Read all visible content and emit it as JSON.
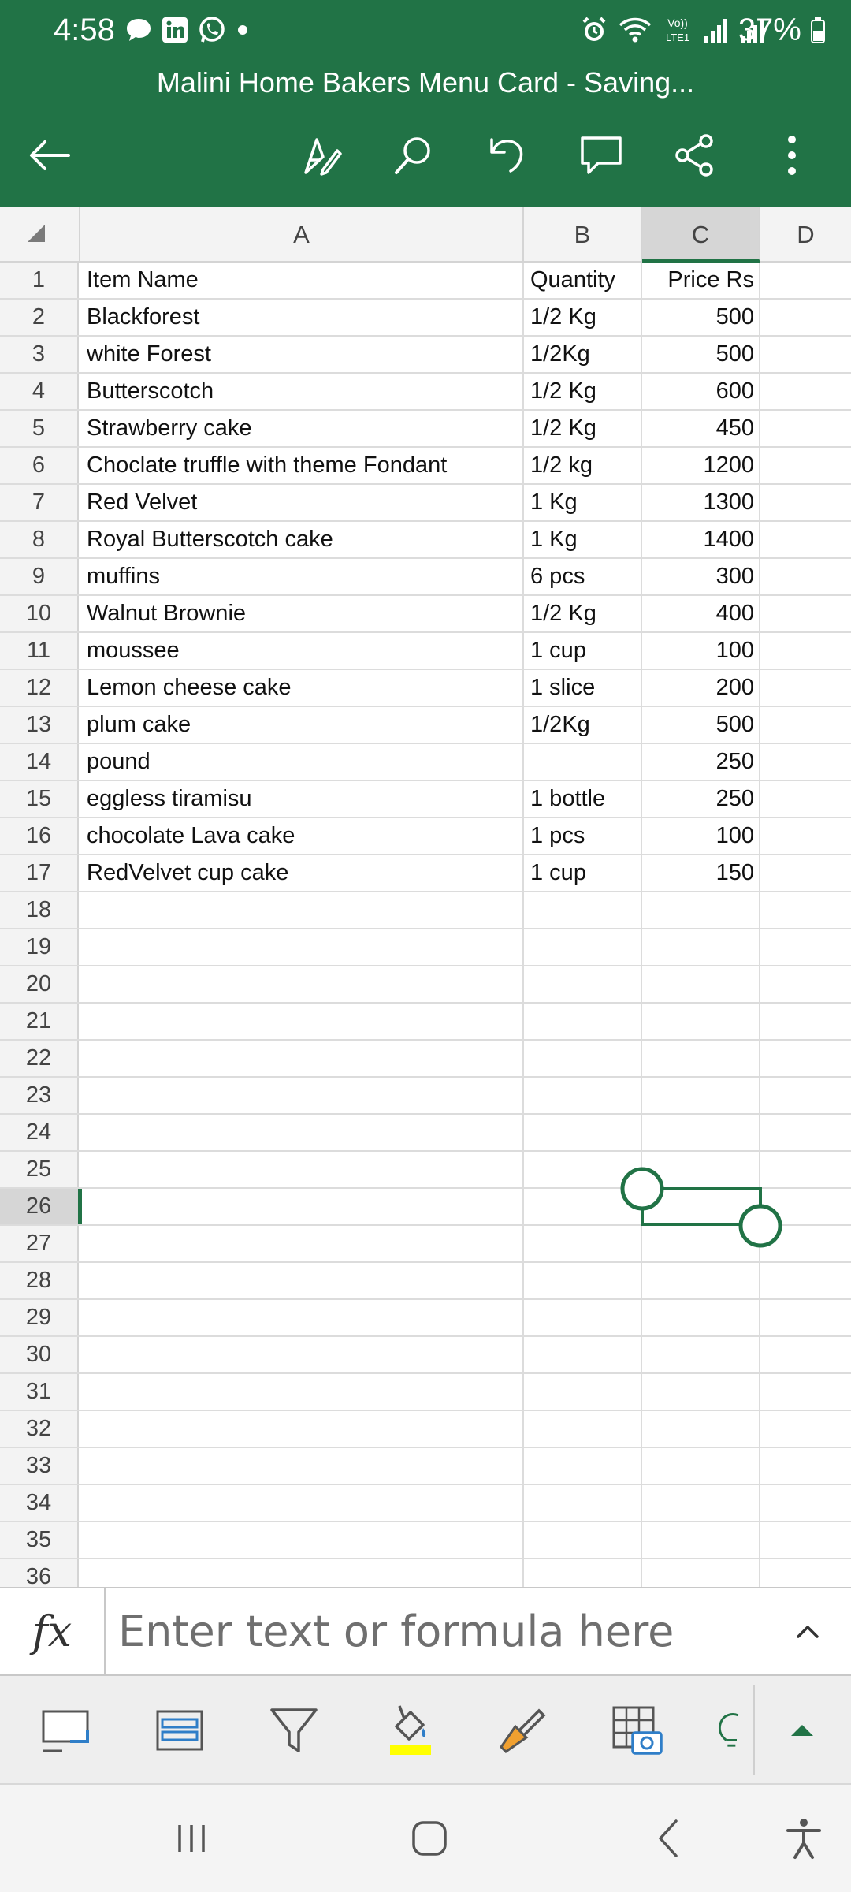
{
  "status_bar": {
    "time": "4:58",
    "battery": "37%",
    "left_icons": [
      "chat-bubble-icon",
      "linkedin-icon",
      "whatsapp-icon",
      "dot-icon"
    ],
    "right_icons": [
      "alarm-icon",
      "wifi-icon",
      "volte-icon",
      "signal-icon",
      "signal-icon",
      "battery-icon"
    ],
    "volte_label": "Vo))\nLTE1"
  },
  "header": {
    "title": "Malini Home Bakers Menu Card - Saving...",
    "toolbar": [
      "back-arrow-icon",
      "draw-pen-icon",
      "search-icon",
      "undo-icon",
      "comment-icon",
      "share-icon",
      "more-vertical-icon"
    ]
  },
  "sheet": {
    "columns": [
      "A",
      "B",
      "C",
      "D"
    ],
    "selected_column": "C",
    "selected_row": 26,
    "rows": [
      {
        "n": "1",
        "a": "Item Name",
        "b": "Quantity",
        "c": "Price Rs"
      },
      {
        "n": "2",
        "a": "Blackforest",
        "b": "1/2 Kg",
        "c": "500"
      },
      {
        "n": "3",
        "a": "white Forest",
        "b": "1/2Kg",
        "c": "500"
      },
      {
        "n": "4",
        "a": "Butterscotch",
        "b": "1/2 Kg",
        "c": "600"
      },
      {
        "n": "5",
        "a": "Strawberry cake",
        "b": "1/2 Kg",
        "c": "450"
      },
      {
        "n": "6",
        "a": "Choclate truffle with theme Fondant",
        "b": "1/2 kg",
        "c": "1200"
      },
      {
        "n": "7",
        "a": "Red Velvet",
        "b": "1 Kg",
        "c": "1300"
      },
      {
        "n": "8",
        "a": "Royal Butterscotch cake",
        "b": "1 Kg",
        "c": "1400"
      },
      {
        "n": "9",
        "a": "muffins",
        "b": "6 pcs",
        "c": "300"
      },
      {
        "n": "10",
        "a": "Walnut Brownie",
        "b": "1/2 Kg",
        "c": "400"
      },
      {
        "n": "11",
        "a": "moussee",
        "b": "1 cup",
        "c": "100"
      },
      {
        "n": "12",
        "a": "Lemon cheese cake",
        "b": "1 slice",
        "c": "200"
      },
      {
        "n": "13",
        "a": "plum cake",
        "b": "1/2Kg",
        "c": "500"
      },
      {
        "n": "14",
        "a": "pound",
        "b": "",
        "c": "250"
      },
      {
        "n": "15",
        "a": "eggless tiramisu",
        "b": "1 bottle",
        "c": "250"
      },
      {
        "n": "16",
        "a": "chocolate Lava cake",
        "b": "1 pcs",
        "c": "100"
      },
      {
        "n": "17",
        "a": "RedVelvet cup cake",
        "b": "1 cup",
        "c": "150"
      },
      {
        "n": "18",
        "a": "",
        "b": "",
        "c": ""
      },
      {
        "n": "19",
        "a": "",
        "b": "",
        "c": ""
      },
      {
        "n": "20",
        "a": "",
        "b": "",
        "c": ""
      },
      {
        "n": "21",
        "a": "",
        "b": "",
        "c": ""
      },
      {
        "n": "22",
        "a": "",
        "b": "",
        "c": ""
      },
      {
        "n": "23",
        "a": "",
        "b": "",
        "c": ""
      },
      {
        "n": "24",
        "a": "",
        "b": "",
        "c": ""
      },
      {
        "n": "25",
        "a": "",
        "b": "",
        "c": ""
      },
      {
        "n": "26",
        "a": "",
        "b": "",
        "c": ""
      },
      {
        "n": "27",
        "a": "",
        "b": "",
        "c": ""
      },
      {
        "n": "28",
        "a": "",
        "b": "",
        "c": ""
      },
      {
        "n": "29",
        "a": "",
        "b": "",
        "c": ""
      },
      {
        "n": "30",
        "a": "",
        "b": "",
        "c": ""
      },
      {
        "n": "31",
        "a": "",
        "b": "",
        "c": ""
      },
      {
        "n": "32",
        "a": "",
        "b": "",
        "c": ""
      },
      {
        "n": "33",
        "a": "",
        "b": "",
        "c": ""
      },
      {
        "n": "34",
        "a": "",
        "b": "",
        "c": ""
      },
      {
        "n": "35",
        "a": "",
        "b": "",
        "c": ""
      },
      {
        "n": "36",
        "a": "",
        "b": "",
        "c": ""
      }
    ]
  },
  "formula_bar": {
    "fx_label": "fx",
    "placeholder": "Enter text or formula here"
  },
  "quick_toolbar": [
    "cell-format-icon",
    "table-layout-icon",
    "filter-icon",
    "fill-color-icon",
    "format-painter-icon",
    "insert-picture-icon",
    "ideas-bulb-icon",
    "expand-up-icon"
  ],
  "navbar": [
    "recent-apps-icon",
    "home-icon",
    "back-icon",
    "accessibility-icon"
  ],
  "colors": {
    "brand_green": "#217346",
    "fill_highlight": "#ffff00",
    "painter_orange": "#f0a030",
    "picture_blue": "#2f7ec8"
  }
}
